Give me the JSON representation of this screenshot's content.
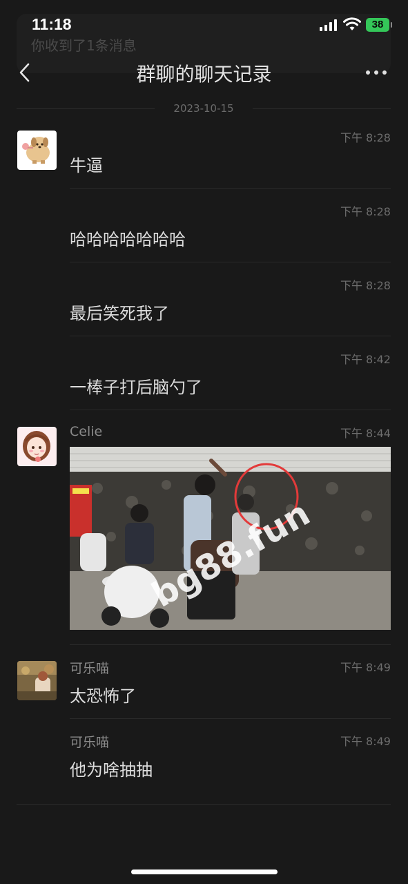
{
  "status": {
    "time": "11:18",
    "battery": "38"
  },
  "notification": {
    "text": "你收到了1条消息"
  },
  "nav": {
    "title": "群聊的聊天记录"
  },
  "date": "2023-10-15",
  "messages": [
    {
      "name": "",
      "time": "下午 8:28",
      "text": "牛逼"
    },
    {
      "name": "",
      "time": "下午 8:28",
      "text": "哈哈哈哈哈哈哈"
    },
    {
      "name": "",
      "time": "下午 8:28",
      "text": "最后笑死我了"
    },
    {
      "name": "",
      "time": "下午 8:42",
      "text": "一棒子打后脑勺了"
    },
    {
      "name": "Celie",
      "time": "下午 8:44",
      "text": ""
    },
    {
      "name": "可乐喵",
      "time": "下午 8:49",
      "text": "太恐怖了"
    },
    {
      "name": "可乐喵",
      "time": "下午 8:49",
      "text": "他为啥抽抽"
    }
  ],
  "image_watermark": "bg88.fun",
  "icons": {
    "back": "chevron-left-icon",
    "more": "more-dots-icon",
    "signal": "signal-icon",
    "wifi": "wifi-icon",
    "battery": "battery-icon"
  },
  "colors": {
    "background": "#191919",
    "battery": "#34c759",
    "text": "#dddddd",
    "meta": "#6d6d6d"
  }
}
